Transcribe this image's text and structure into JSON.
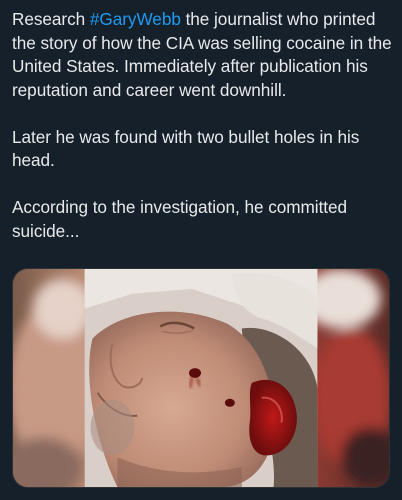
{
  "tweet": {
    "paragraph1": {
      "lead": "Research ",
      "hashtag": "#GaryWebb",
      "rest": " the journalist who printed the story of how the CIA was selling cocaine in the United States. Immediately after publication his reputation and career went downhill."
    },
    "paragraph2": "Later he was found with two bullet holes in his head.",
    "paragraph3": "According to the investigation, he committed suicide...",
    "hashtag_color": "#1d9bf0",
    "background_color": "#15202b",
    "text_color": "#e7e9ea"
  },
  "media": {
    "icon": "photo-attachment"
  }
}
